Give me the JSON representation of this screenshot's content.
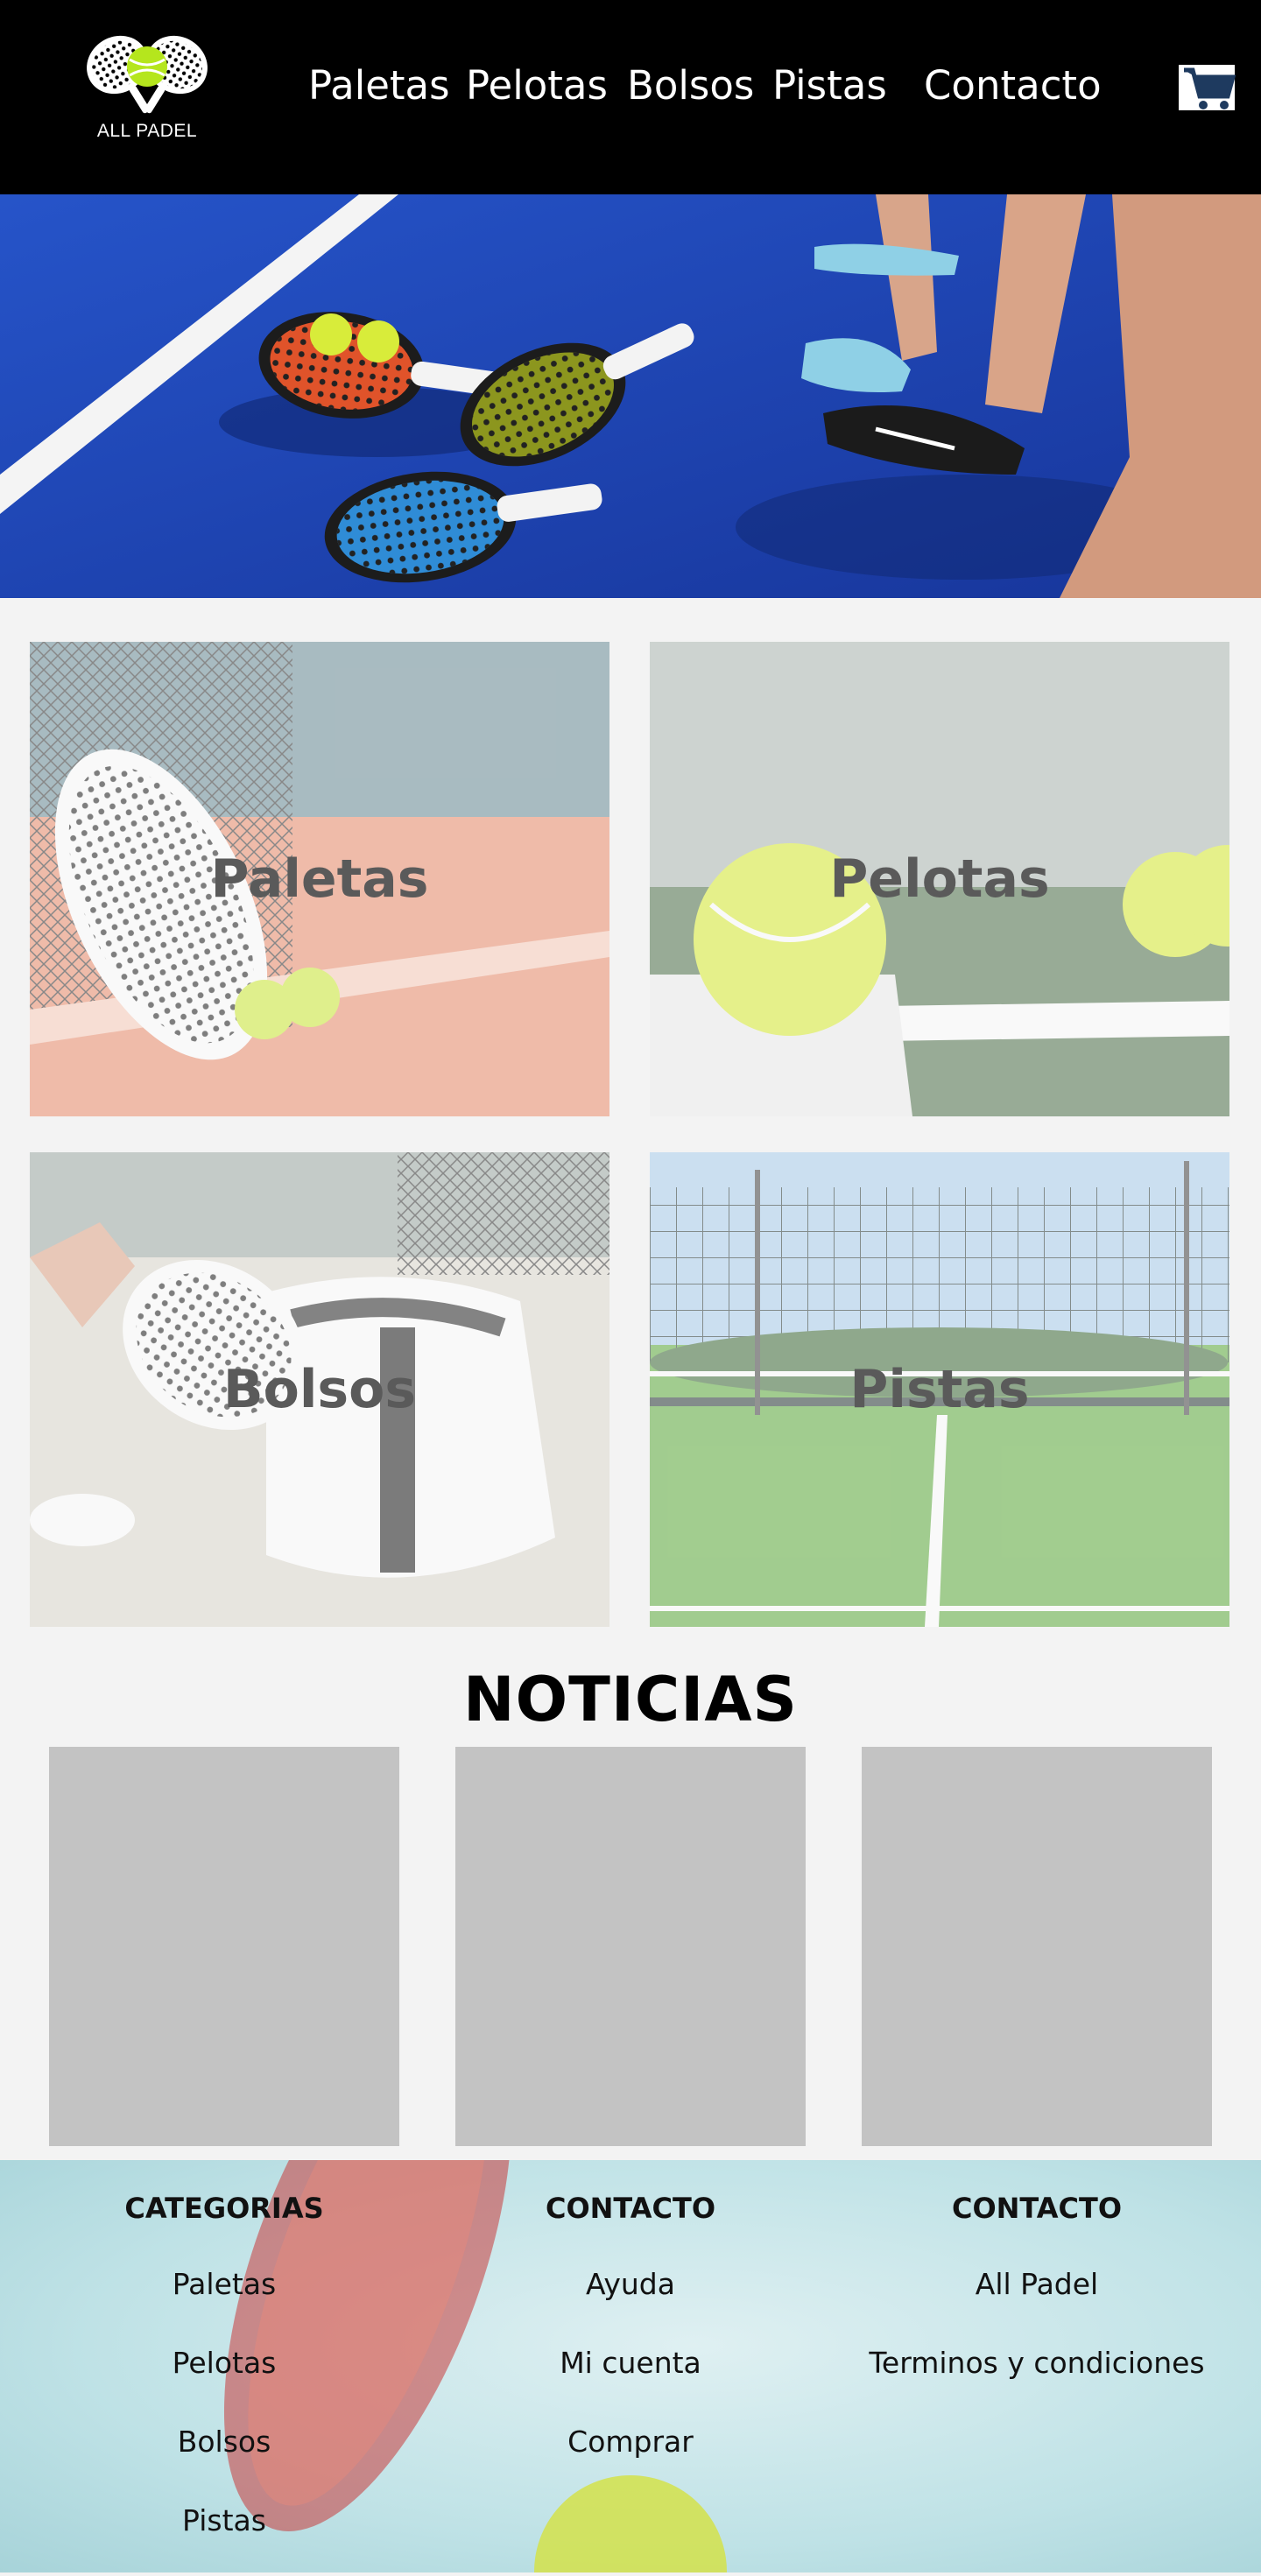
{
  "brand": {
    "name": "ALL PADEL"
  },
  "nav": {
    "items": [
      {
        "label": "Paletas"
      },
      {
        "label": "Pelotas"
      },
      {
        "label": "Bolsos"
      },
      {
        "label": "Pistas"
      },
      {
        "label": "Contacto"
      }
    ]
  },
  "header": {
    "cart_icon": "shopping-cart-icon"
  },
  "categories": [
    {
      "label": "Paletas"
    },
    {
      "label": "Pelotas"
    },
    {
      "label": "Bolsos"
    },
    {
      "label": "Pistas"
    }
  ],
  "news": {
    "title": "NOTICIAS"
  },
  "footer": {
    "columns": [
      {
        "heading": "CATEGORIAS",
        "links": [
          "Paletas",
          "Pelotas",
          "Bolsos",
          "Pistas"
        ]
      },
      {
        "heading": "CONTACTO",
        "links": [
          "Ayuda",
          "Mi cuenta",
          "Comprar"
        ]
      },
      {
        "heading": "CONTACTO",
        "links": [
          "All Padel",
          "Terminos y condiciones"
        ]
      }
    ]
  },
  "colors": {
    "header_bg": "#000000",
    "court_blue": "#2147b8",
    "ball_yellow": "#c8e62a",
    "page_bg": "#f3f3f3",
    "news_card": "#c3c3c3"
  }
}
